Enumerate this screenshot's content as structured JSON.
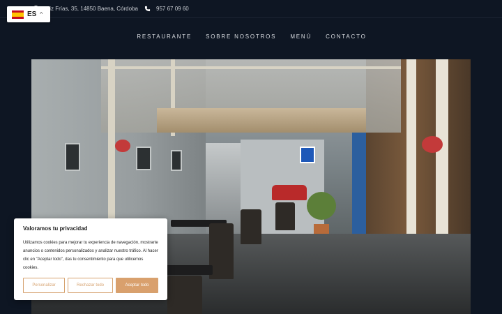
{
  "topbar": {
    "address": "Ruiz Frías, 35, 14850 Baena, Córdoba",
    "phone": "957 67 09 60"
  },
  "language": {
    "code": "ES"
  },
  "nav": {
    "items": [
      "RESTAURANTE",
      "SOBRE NOSOTROS",
      "MENÚ",
      "CONTACTO"
    ]
  },
  "cookie": {
    "title": "Valoramos tu privacidad",
    "text": "Utilizamos cookies para mejorar tu experiencia de navegación, mostrarte anuncios o contenidos personalizados y analizar nuestro tráfico. Al hacer clic en \"Aceptar todo\", das tu consentimiento para que utilicemos cookies.",
    "customize_label": "Personalizar",
    "reject_label": "Rechazar todo",
    "accept_label": "Aceptar todo"
  },
  "colors": {
    "background": "#0e1623",
    "accent": "#d9a06d"
  }
}
